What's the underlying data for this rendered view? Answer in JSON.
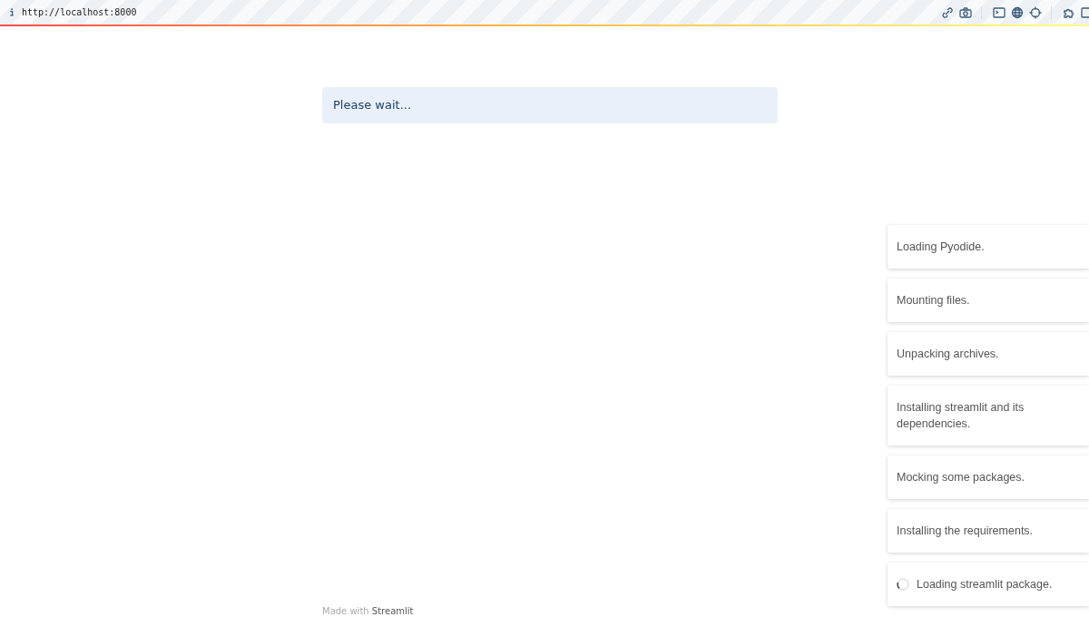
{
  "address_bar": {
    "url": "http://localhost:8000"
  },
  "alert": {
    "text": "Please wait..."
  },
  "toasts": [
    {
      "text": "Loading Pyodide.",
      "loading": false
    },
    {
      "text": "Mounting files.",
      "loading": false
    },
    {
      "text": "Unpacking archives.",
      "loading": false
    },
    {
      "text": "Installing streamlit and its dependencies.",
      "loading": false
    },
    {
      "text": "Mocking some packages.",
      "loading": false
    },
    {
      "text": "Installing the requirements.",
      "loading": false
    },
    {
      "text": "Loading streamlit package.",
      "loading": true
    }
  ],
  "footer": {
    "prefix": "Made with",
    "brand": "Streamlit"
  }
}
